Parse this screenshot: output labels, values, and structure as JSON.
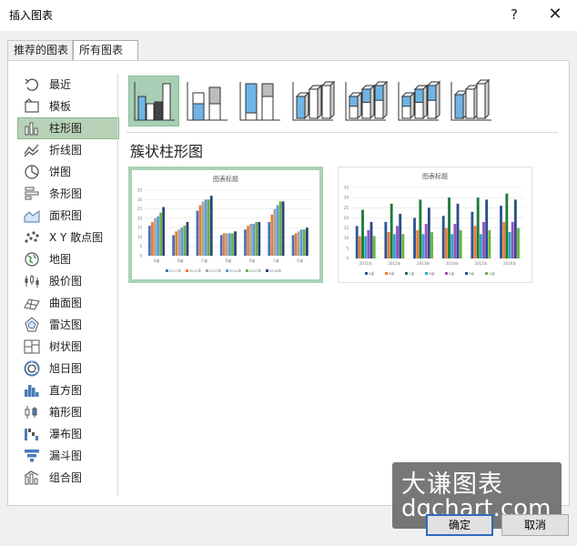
{
  "dialog": {
    "title": "插入图表",
    "help_label": "?",
    "close_label": "✕"
  },
  "tabs": [
    {
      "label": "推荐的图表",
      "selected": false
    },
    {
      "label": "所有图表",
      "selected": true
    }
  ],
  "sidebar": {
    "items": [
      {
        "label": "最近",
        "icon": "recent-icon"
      },
      {
        "label": "模板",
        "icon": "template-icon"
      },
      {
        "label": "柱形图",
        "icon": "column-chart-icon",
        "selected": true
      },
      {
        "label": "折线图",
        "icon": "line-chart-icon"
      },
      {
        "label": "饼图",
        "icon": "pie-chart-icon"
      },
      {
        "label": "条形图",
        "icon": "bar-chart-icon"
      },
      {
        "label": "面积图",
        "icon": "area-chart-icon"
      },
      {
        "label": "X Y 散点图",
        "icon": "scatter-chart-icon"
      },
      {
        "label": "地图",
        "icon": "map-chart-icon"
      },
      {
        "label": "股价图",
        "icon": "stock-chart-icon"
      },
      {
        "label": "曲面图",
        "icon": "surface-chart-icon"
      },
      {
        "label": "雷达图",
        "icon": "radar-chart-icon"
      },
      {
        "label": "树状图",
        "icon": "treemap-chart-icon"
      },
      {
        "label": "旭日图",
        "icon": "sunburst-chart-icon"
      },
      {
        "label": "直方图",
        "icon": "histogram-chart-icon"
      },
      {
        "label": "箱形图",
        "icon": "box-whisker-chart-icon"
      },
      {
        "label": "瀑布图",
        "icon": "waterfall-chart-icon"
      },
      {
        "label": "漏斗图",
        "icon": "funnel-chart-icon"
      },
      {
        "label": "组合图",
        "icon": "combo-chart-icon"
      }
    ]
  },
  "subtypes": [
    "clustered-column-icon",
    "stacked-column-icon",
    "100-stacked-column-icon",
    "3d-clustered-column-icon",
    "3d-stacked-column-icon",
    "3d-100-stacked-column-icon",
    "3d-column-icon"
  ],
  "main": {
    "heading": "簇状柱形图"
  },
  "colors": {
    "accent_selected": "#a8cfb5",
    "series": [
      "#4472c4",
      "#ed7d31",
      "#a5a5a5",
      "#5b9bd5",
      "#70ad47",
      "#264478",
      "#9e480e"
    ],
    "preview_series": [
      "#2f5597",
      "#ed7d31",
      "#1e7b3a",
      "#31a4c9",
      "#9c4fc4",
      "#2a4e8a",
      "#6db33f"
    ]
  },
  "chart_data": [
    {
      "type": "bar",
      "title": "图表标题",
      "categories": [
        "A省",
        "B省",
        "C省",
        "D省",
        "E省",
        "F省",
        "G省"
      ],
      "ylim": [
        0,
        35
      ],
      "yticks": [
        "0",
        "5",
        "10",
        "15",
        "20",
        "25",
        "30",
        "35"
      ],
      "series": [
        {
          "name": "2011年",
          "values": [
            16,
            11,
            24,
            11,
            14,
            18,
            11
          ]
        },
        {
          "name": "2012年",
          "values": [
            18,
            13,
            27,
            12,
            16,
            22,
            12
          ]
        },
        {
          "name": "2013年",
          "values": [
            20,
            14,
            29,
            12,
            17,
            25,
            13
          ]
        },
        {
          "name": "2014年",
          "values": [
            21,
            15,
            30,
            12,
            17,
            27,
            14
          ]
        },
        {
          "name": "2015年",
          "values": [
            23,
            16,
            30,
            12,
            18,
            29,
            14
          ]
        },
        {
          "name": "2016年",
          "values": [
            26,
            18,
            32,
            13,
            18,
            29,
            15
          ]
        }
      ],
      "legend": "bottom",
      "grid": true
    },
    {
      "type": "bar",
      "title": "图表标题",
      "categories": [
        "2011年",
        "2012年",
        "2013年",
        "2014年",
        "2015年",
        "2016年"
      ],
      "ylim": [
        0,
        35
      ],
      "yticks": [
        "0",
        "5",
        "10",
        "15",
        "20",
        "25",
        "30",
        "35"
      ],
      "series": [
        {
          "name": "A省",
          "values": [
            16,
            18,
            20,
            21,
            23,
            26
          ]
        },
        {
          "name": "B省",
          "values": [
            11,
            13,
            14,
            15,
            16,
            18
          ]
        },
        {
          "name": "C省",
          "values": [
            24,
            27,
            29,
            30,
            30,
            32
          ]
        },
        {
          "name": "D省",
          "values": [
            11,
            12,
            12,
            12,
            12,
            13
          ]
        },
        {
          "name": "E省",
          "values": [
            14,
            16,
            17,
            17,
            18,
            18
          ]
        },
        {
          "name": "F省",
          "values": [
            18,
            22,
            25,
            27,
            29,
            29
          ]
        },
        {
          "name": "G省",
          "values": [
            11,
            12,
            13,
            14,
            14,
            15
          ]
        }
      ],
      "legend": "bottom",
      "grid": true
    }
  ],
  "watermark": {
    "line1": "大谦图表",
    "line2": "dqchart.com"
  },
  "buttons": {
    "ok_label": "确定",
    "cancel_label": "取消"
  }
}
